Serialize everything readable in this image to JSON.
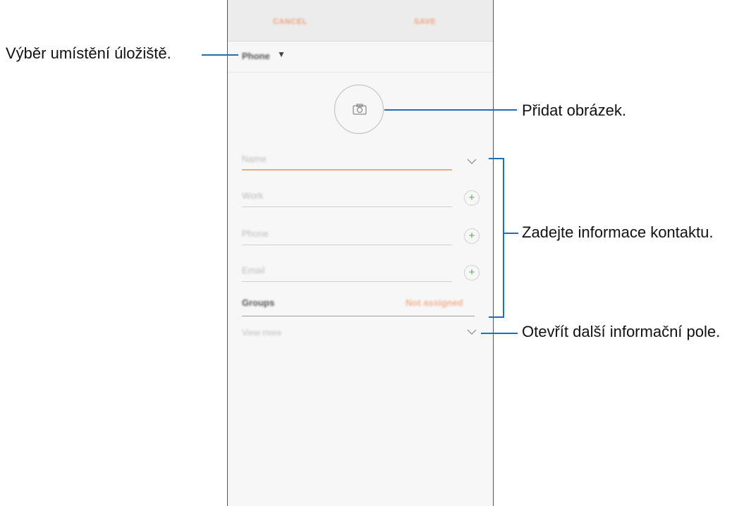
{
  "toolbar": {
    "cancel_label": "CANCEL",
    "save_label": "SAVE"
  },
  "storage": {
    "selected": "Phone"
  },
  "fields": {
    "name_placeholder": "Name",
    "work_placeholder": "Work",
    "phone_placeholder": "Phone",
    "email_placeholder": "Email"
  },
  "groups": {
    "label": "Groups",
    "value": "Not assigned"
  },
  "view_more_label": "View more",
  "callouts": {
    "storage": "Výběr umístění úložiště.",
    "photo": "Přidat obrázek.",
    "contact_info": "Zadejte informace kontaktu.",
    "more_fields": "Otevřít další informační pole."
  },
  "colors": {
    "accent": "#f2a27e",
    "callout_line": "#1d6fb8",
    "add_icon": "#4caf50"
  },
  "icons": [
    "camera-icon",
    "chevron-down-icon",
    "plus-icon",
    "caret-down-icon"
  ]
}
